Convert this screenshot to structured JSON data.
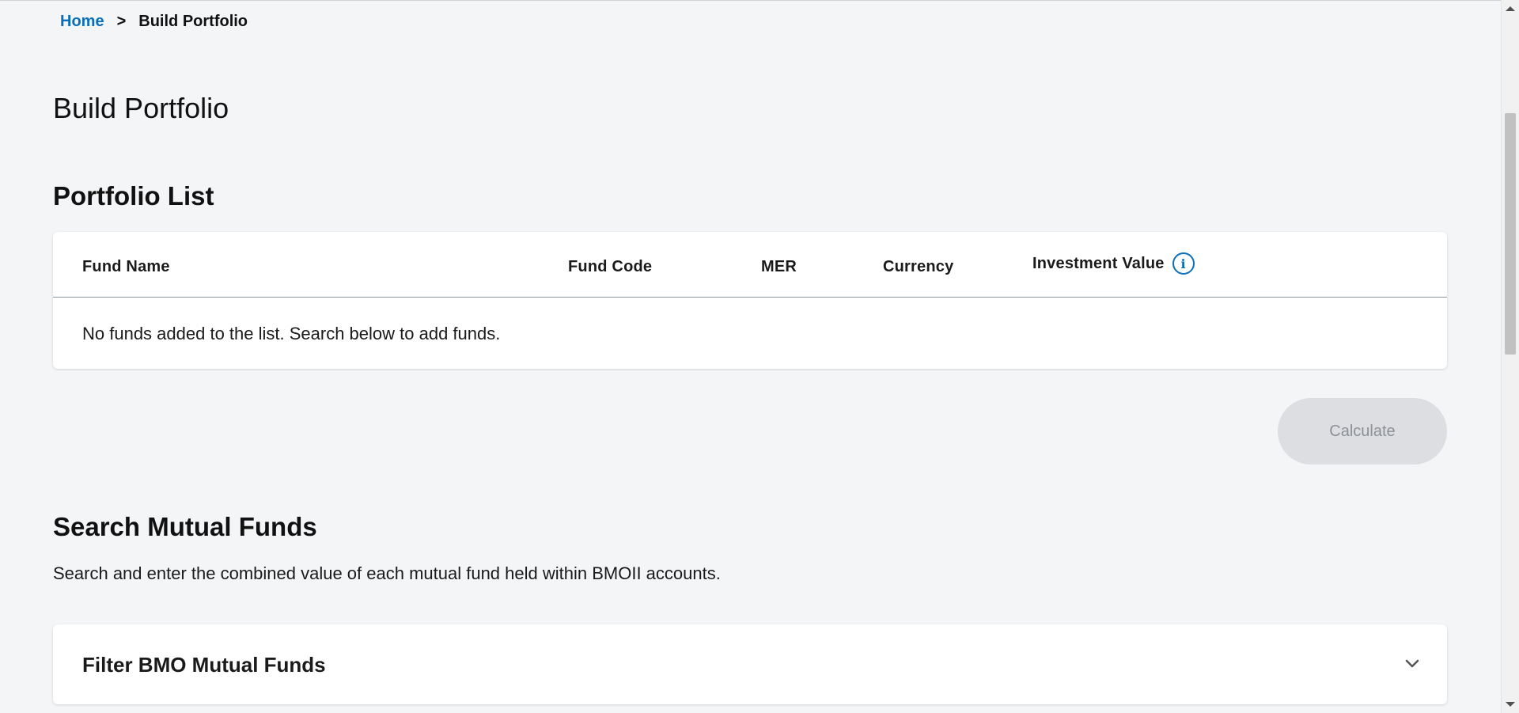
{
  "breadcrumb": {
    "home": "Home",
    "separator": ">",
    "current": "Build Portfolio"
  },
  "page_title": "Build Portfolio",
  "portfolio_list": {
    "title": "Portfolio List",
    "columns": [
      "Fund Name",
      "Fund Code",
      "MER",
      "Currency",
      "Investment Value"
    ],
    "empty_message": "No funds added to the list. Search below to add funds.",
    "info_icon": "info-icon"
  },
  "calculate_button": "Calculate",
  "search": {
    "title": "Search Mutual Funds",
    "description": "Search and enter the combined value of each mutual fund held within BMOII accounts.",
    "filter_title": "Filter BMO Mutual Funds"
  },
  "colors": {
    "accent": "#0a6fb8",
    "background": "#f4f5f7",
    "button_disabled_bg": "#dcdee1",
    "button_disabled_text": "#8d9196"
  }
}
